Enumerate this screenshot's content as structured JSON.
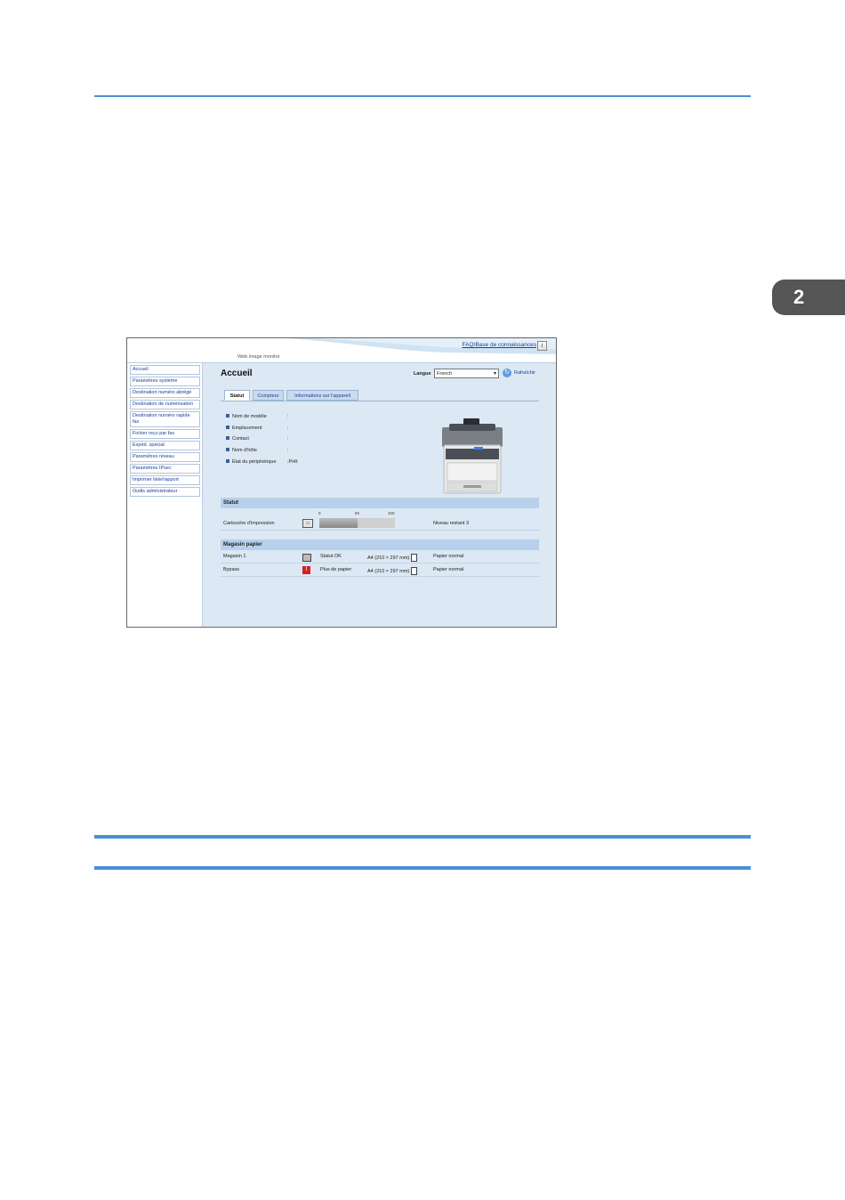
{
  "document": {
    "chapter_number": "2"
  },
  "web_image_monitor": {
    "header": {
      "faq_link": "FAQ/Base de connaissances",
      "app_name": "Web image monitor"
    },
    "sidebar": {
      "items": [
        {
          "label": "Accueil"
        },
        {
          "label": "Paramètres système"
        },
        {
          "label": "Destination numéro abrégé"
        },
        {
          "label": "Destination de numérisation"
        },
        {
          "label": "Destination numéro rapide fax"
        },
        {
          "label": "Fichier reçu par fax"
        },
        {
          "label": "Expéd. spécial"
        },
        {
          "label": "Paramètres réseau"
        },
        {
          "label": "Paramètres IPsec"
        },
        {
          "label": "Imprimer liste/rapport"
        },
        {
          "label": "Outils administrateur"
        }
      ]
    },
    "main": {
      "title": "Accueil",
      "language_label": "Langue",
      "language_value": "French",
      "refresh_label": "Rafraîchir",
      "tabs": [
        {
          "label": "Statut",
          "active": true
        },
        {
          "label": "Compteur",
          "active": false
        },
        {
          "label": "Informations sur l'appareil",
          "active": false
        }
      ],
      "device_info": [
        {
          "label": "Nom de modèle",
          "value": ":"
        },
        {
          "label": "Emplacement",
          "value": ":"
        },
        {
          "label": "Contact",
          "value": ":"
        },
        {
          "label": "Nom d'hôte",
          "value": ":"
        },
        {
          "label": "État du périphérique",
          "value": ":Prêt"
        }
      ],
      "status_section": {
        "title": "Statut",
        "scale": [
          "0",
          "50",
          "100"
        ],
        "cartridge_label": "Cartouche d'impression",
        "cartridge_level_fraction": 0.5,
        "remaining_text": "Niveau restant 3"
      },
      "paper_section": {
        "title": "Magasin papier",
        "rows": [
          {
            "tray": "Magasin 1",
            "status": "Statut OK",
            "size": "A4 (210 × 297 mm)",
            "type": "Papier normal",
            "status_color": "#555555"
          },
          {
            "tray": "Bypass",
            "status": "Plus de papier",
            "size": "A4 (210 × 297 mm)",
            "type": "Papier normal",
            "status_color": "#d82020"
          }
        ]
      }
    }
  }
}
